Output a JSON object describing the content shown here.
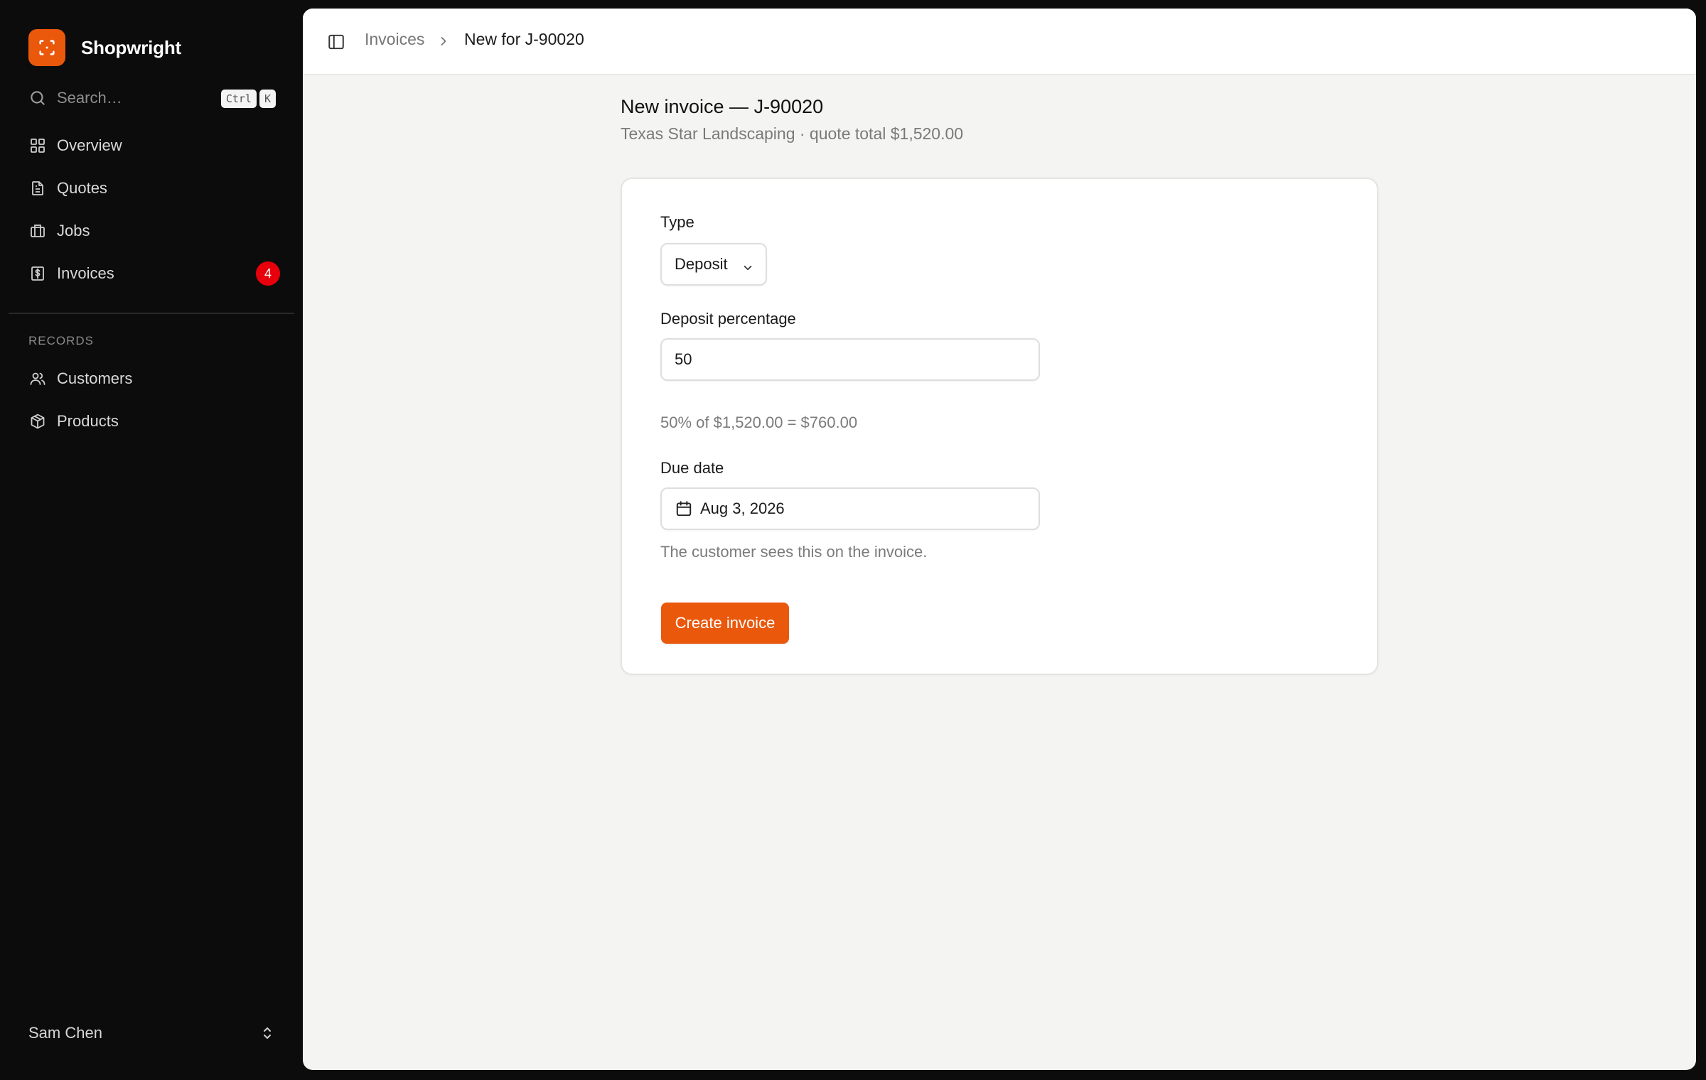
{
  "app": {
    "name": "Shopwright",
    "accent_color": "#ea580c",
    "logo_icon": "scan-icon"
  },
  "sidebar": {
    "search": {
      "placeholder": "Search…",
      "shortcut": [
        "Ctrl",
        "K"
      ],
      "icon": "search-icon"
    },
    "nav": [
      {
        "label": "Overview",
        "icon": "grid-icon"
      },
      {
        "label": "Quotes",
        "icon": "document-icon"
      },
      {
        "label": "Jobs",
        "icon": "briefcase-icon"
      },
      {
        "label": "Invoices",
        "icon": "receipt-icon",
        "badge": "4",
        "badge_color": "#e7000b"
      }
    ],
    "records_section": {
      "heading": "RECORDS",
      "items": [
        {
          "label": "Customers",
          "icon": "users-icon"
        },
        {
          "label": "Products",
          "icon": "package-icon"
        }
      ]
    },
    "user": {
      "name": "Sam Chen",
      "icon": "chevrons-up-down-icon"
    }
  },
  "topbar": {
    "toggle_icon": "sidebar-toggle-icon",
    "breadcrumb": [
      "Invoices",
      "New for J-90020"
    ]
  },
  "page": {
    "title": "New invoice — J-90020",
    "subtitle": "Texas Star Landscaping · quote total $1,520.00"
  },
  "form": {
    "type": {
      "label": "Type",
      "value": "Deposit"
    },
    "deposit_percentage": {
      "label": "Deposit percentage",
      "value": "50",
      "calculation": "50% of $1,520.00 = $760.00"
    },
    "due_date": {
      "label": "Due date",
      "value": "Aug 3, 2026",
      "hint": "The customer sees this on the invoice."
    },
    "submit_label": "Create invoice"
  }
}
